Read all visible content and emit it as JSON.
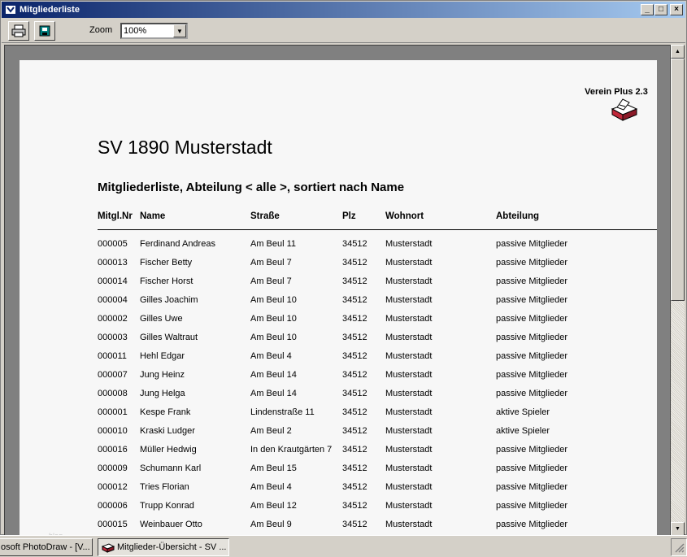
{
  "window": {
    "title": "Mitgliederliste",
    "minimize": "_",
    "maximize": "□",
    "close": "×"
  },
  "toolbar": {
    "zoom_label": "Zoom",
    "zoom_value": "100%"
  },
  "report": {
    "brand": "Verein Plus 2.3",
    "club": "SV 1890 Musterstadt",
    "subtitle": "Mitgliederliste, Abteilung < alle >, sortiert nach Name",
    "columns": [
      "Mitgl.Nr",
      "Name",
      "Straße",
      "Plz",
      "Wohnort",
      "Abteilung"
    ],
    "rows": [
      [
        "000005",
        "Ferdinand Andreas",
        "Am Beul 11",
        "34512",
        "Musterstadt",
        "passive Mitglieder"
      ],
      [
        "000013",
        "Fischer Betty",
        "Am Beul 7",
        "34512",
        "Musterstadt",
        "passive Mitglieder"
      ],
      [
        "000014",
        "Fischer Horst",
        "Am Beul 7",
        "34512",
        "Musterstadt",
        "passive Mitglieder"
      ],
      [
        "000004",
        "Gilles Joachim",
        "Am Beul 10",
        "34512",
        "Musterstadt",
        "passive Mitglieder"
      ],
      [
        "000002",
        "Gilles Uwe",
        "Am Beul 10",
        "34512",
        "Musterstadt",
        "passive Mitglieder"
      ],
      [
        "000003",
        "Gilles Waltraut",
        "Am Beul 10",
        "34512",
        "Musterstadt",
        "passive Mitglieder"
      ],
      [
        "000011",
        "Hehl Edgar",
        "Am Beul 4",
        "34512",
        "Musterstadt",
        "passive Mitglieder"
      ],
      [
        "000007",
        "Jung Heinz",
        "Am Beul 14",
        "34512",
        "Musterstadt",
        "passive Mitglieder"
      ],
      [
        "000008",
        "Jung Helga",
        "Am Beul 14",
        "34512",
        "Musterstadt",
        "passive Mitglieder"
      ],
      [
        "000001",
        "Kespe Frank",
        "Lindenstraße 11",
        "34512",
        "Musterstadt",
        "aktive Spieler"
      ],
      [
        "000010",
        "Kraski Ludger",
        "Am Beul 2",
        "34512",
        "Musterstadt",
        "aktive Spieler"
      ],
      [
        "000016",
        "Müller Hedwig",
        "In den Krautgärten 7",
        "34512",
        "Musterstadt",
        "passive Mitglieder"
      ],
      [
        "000009",
        "Schumann Karl",
        "Am Beul 15",
        "34512",
        "Musterstadt",
        "passive Mitglieder"
      ],
      [
        "000012",
        "Tries Florian",
        "Am Beul 4",
        "34512",
        "Musterstadt",
        "passive Mitglieder"
      ],
      [
        "000006",
        "Trupp Konrad",
        "Am Beul 12",
        "34512",
        "Musterstadt",
        "passive Mitglieder"
      ],
      [
        "000015",
        "Weinbauer Otto",
        "Am Beul 9",
        "34512",
        "Musterstadt",
        "passive Mitglieder"
      ]
    ],
    "watermark": "blog"
  },
  "taskbar": {
    "items": [
      "osoft PhotoDraw - [V...",
      "Mitglieder-Übersicht - SV ..."
    ]
  }
}
